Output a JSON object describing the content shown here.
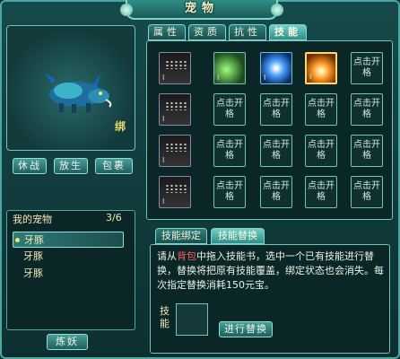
{
  "window": {
    "title": "宠物"
  },
  "pet_view": {
    "bind_label": "绑"
  },
  "pet_actions": [
    {
      "label": "休战"
    },
    {
      "label": "放生"
    },
    {
      "label": "包裹"
    }
  ],
  "pet_list": {
    "header": "我的宠物",
    "count": "3/6",
    "items": [
      {
        "name": "牙豚",
        "selected": true
      },
      {
        "name": "牙豚",
        "selected": false
      },
      {
        "name": "牙豚",
        "selected": false
      }
    ],
    "refine_button": "炼妖"
  },
  "tabs": [
    {
      "label": "属性",
      "active": false
    },
    {
      "label": "资质",
      "active": false
    },
    {
      "label": "抗性",
      "active": false
    },
    {
      "label": "技能",
      "active": true
    }
  ],
  "skill_grid": {
    "left_column_roman": "I",
    "open_slot_text": "点击开格",
    "learned_skills": [
      {
        "icon": "green-vine-skill-icon"
      },
      {
        "icon": "blue-light-skill-icon"
      },
      {
        "icon": "orange-fire-skill-icon"
      }
    ]
  },
  "subtabs": [
    {
      "label": "技能绑定",
      "active": false
    },
    {
      "label": "技能替换",
      "active": true
    }
  ],
  "replace_panel": {
    "desc_before": "请从",
    "desc_highlight": "背包",
    "desc_after": "中拖入技能书，选中一个已有技能进行替换，替换将把原有技能覆盖，绑定状态也会消失。每次指定替换消耗150元宝。",
    "skill_label": "技能",
    "confirm_button": "进行替换"
  },
  "colors": {
    "accent": "#4aa7a4",
    "highlight": "#ff5a5a",
    "gold_text": "#f1e8b8"
  }
}
